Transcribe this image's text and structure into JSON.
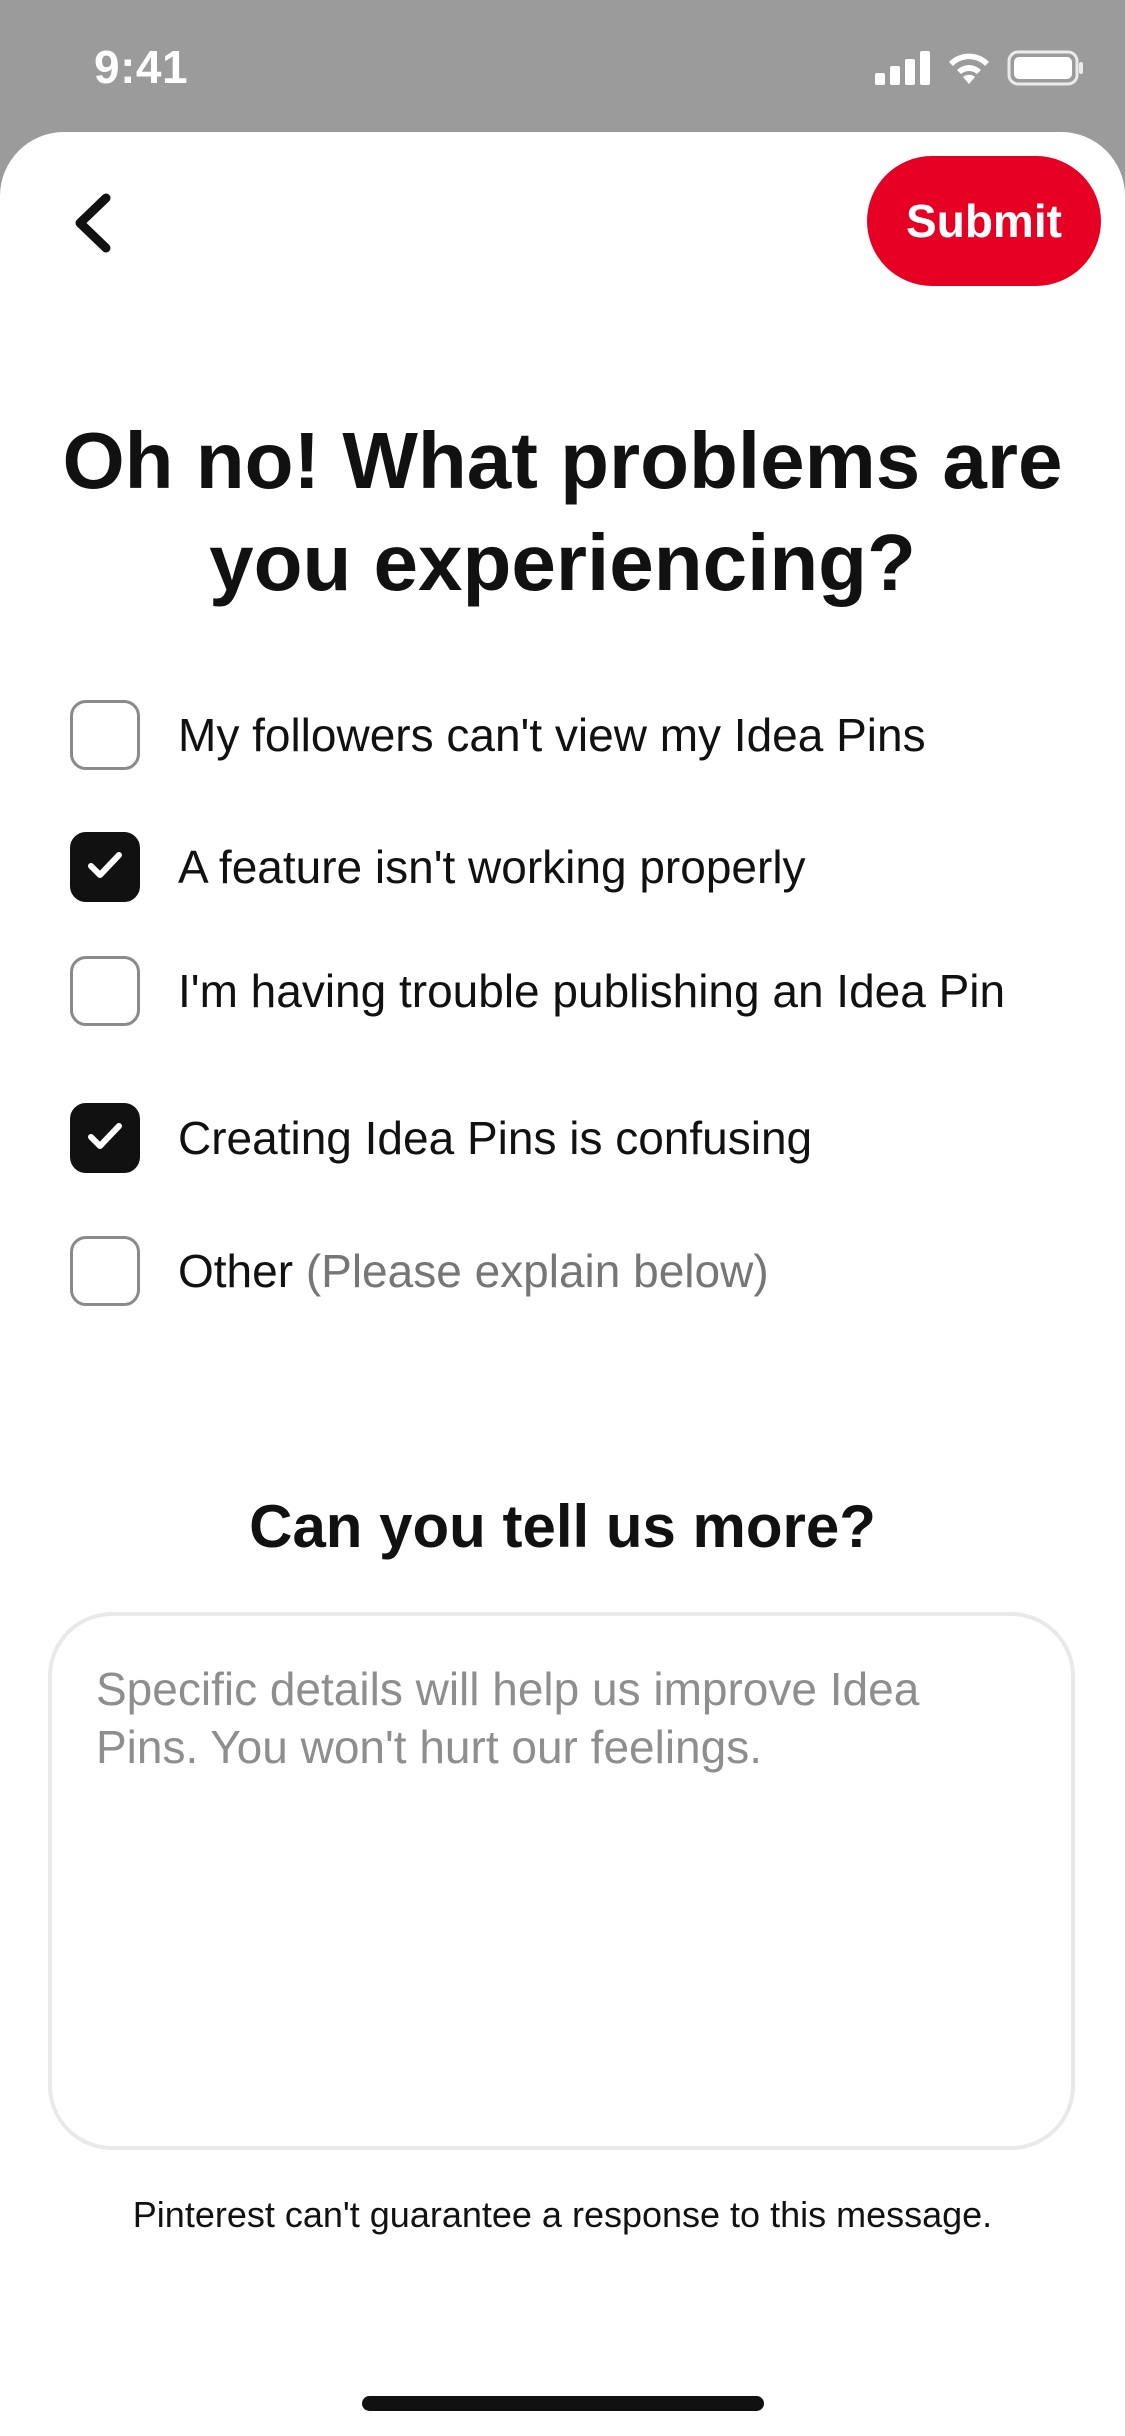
{
  "status_bar": {
    "time": "9:41"
  },
  "header": {
    "back_icon": "chevron-left-icon",
    "submit_label": "Submit",
    "submit_color": "#e60023"
  },
  "title": "Oh no! What problems are you experiencing?",
  "options": [
    {
      "label": "My followers can't view my Idea Pins",
      "hint": "",
      "checked": false
    },
    {
      "label": "A feature isn't working properly",
      "hint": "",
      "checked": true
    },
    {
      "label": "I'm having trouble publishing an Idea Pin",
      "hint": "",
      "checked": false
    },
    {
      "label": "Creating Idea Pins is confusing",
      "hint": "",
      "checked": true
    },
    {
      "label": "Other",
      "hint": "(Please explain below)",
      "checked": false
    }
  ],
  "more": {
    "title": "Can you tell us more?",
    "placeholder": "Specific details will help us improve Idea Pins. You won't hurt our feelings.",
    "value": ""
  },
  "disclaimer": "Pinterest can't guarantee a response to this message."
}
